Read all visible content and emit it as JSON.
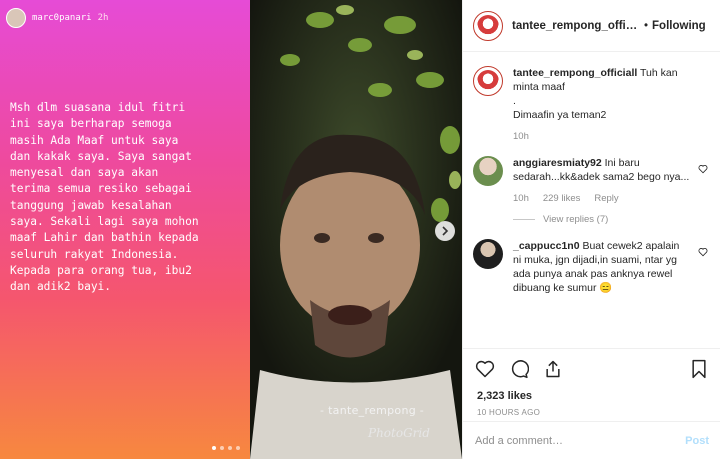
{
  "story": {
    "username": "marc0panari",
    "time": "2h",
    "text": "Msh dlm suasana idul fitri\nini saya berharap semoga\nmasih Ada Maaf untuk saya\ndan kakak saya. Saya sangat\nmenyesal dan saya akan\nterima semua resiko sebagai\ntanggung jawab kesalahan\nsaya. Sekali lagi saya mohon\nmaaf Lahir dan bathin kepada\nseluruh rakyat Indonesia.\nKepada para orang tua, ibu2\ndan adik2 bayi."
  },
  "video": {
    "watermark": "- tante_rempong -",
    "photogrid": "PhotoGrid"
  },
  "post": {
    "username": "tantee_rempong_official",
    "follow_label": "Following",
    "caption_user": "tantee_rempong_officiall",
    "caption_text": "Tuh kan minta maaf",
    "caption_dot": ".",
    "caption_line2": "Dimaafin ya teman2",
    "caption_time": "10h",
    "comments": [
      {
        "user": "anggiaresmiaty92",
        "text": "Ini baru sedarah...kk&adek sama2 bego nya...",
        "time": "10h",
        "likes": "229 likes",
        "reply": "Reply",
        "view_replies": "View replies (7)"
      },
      {
        "user": "_cappucc1n0",
        "text": "Buat cewek2 apalain ni muka, jgn dijadi,in suami, ntar yg ada punya anak pas anknya rewel dibuang ke sumur 😑"
      }
    ],
    "likes": "2,323 likes",
    "timestamp": "10 HOURS AGO",
    "add_placeholder": "Add a comment…",
    "post_label": "Post"
  },
  "colors": {
    "gradient_top": "#e64bd6",
    "gradient_bottom": "#f7883f",
    "post_blue_disabled": "#b2dffc",
    "avatar_ring": "#c0392b"
  },
  "icons": [
    "heart-icon",
    "comment-icon",
    "share-icon",
    "bookmark-icon",
    "chevron-right-icon"
  ]
}
